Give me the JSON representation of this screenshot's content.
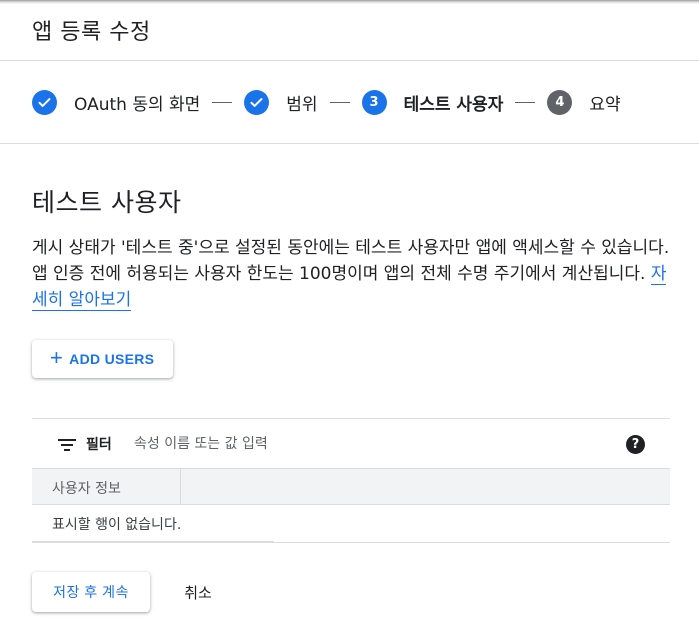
{
  "header": {
    "title": "앱 등록 수정"
  },
  "stepper": {
    "steps": [
      {
        "label": "OAuth 동의 화면",
        "status": "done",
        "icon": "check-icon"
      },
      {
        "label": "범위",
        "status": "done",
        "icon": "check-icon"
      },
      {
        "label": "테스트 사용자",
        "status": "current",
        "number": "3"
      },
      {
        "label": "요약",
        "status": "todo",
        "number": "4"
      }
    ]
  },
  "section": {
    "title": "테스트 사용자",
    "description": "게시 상태가 '테스트 중'으로 설정된 동안에는 테스트 사용자만 앱에 액세스할 수 있습니다. 앱 인증 전에 허용되는 사용자 한도는 100명이며 앱의 전체 수명 주기에서 계산됩니다.",
    "learn_more_link": "자세히 알아보기"
  },
  "add_users": {
    "label": "ADD USERS",
    "icon": "plus-icon"
  },
  "filter": {
    "label": "필터",
    "placeholder": "속성 이름 또는 값 입력",
    "icon": "filter-icon",
    "help_icon": "help-icon",
    "help_glyph": "?"
  },
  "table": {
    "columns": [
      "사용자 정보"
    ],
    "empty_text": "표시할 행이 없습니다."
  },
  "actions": {
    "save_label": "저장 후 계속",
    "cancel_label": "취소"
  },
  "colors": {
    "accent": "#1a73e8",
    "todo_step": "#5f6368",
    "table_header_bg": "#f1f3f4"
  }
}
